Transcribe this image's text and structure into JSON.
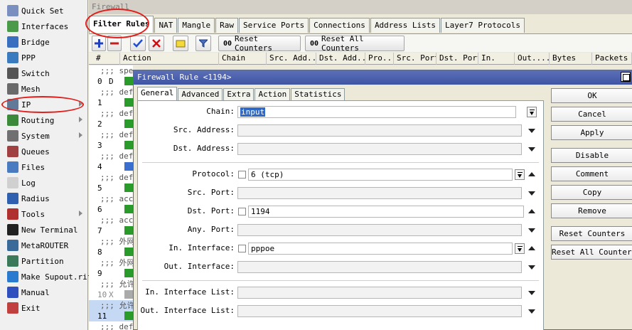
{
  "sidebar": {
    "items": [
      {
        "label": "Quick Set",
        "icon": "quick-set-icon",
        "arrow": false
      },
      {
        "label": "Interfaces",
        "icon": "interfaces-icon",
        "arrow": false
      },
      {
        "label": "Bridge",
        "icon": "bridge-icon",
        "arrow": false
      },
      {
        "label": "PPP",
        "icon": "ppp-icon",
        "arrow": false
      },
      {
        "label": "Switch",
        "icon": "switch-icon",
        "arrow": false
      },
      {
        "label": "Mesh",
        "icon": "mesh-icon",
        "arrow": false
      },
      {
        "label": "IP",
        "icon": "ip-icon",
        "arrow": true
      },
      {
        "label": "Routing",
        "icon": "routing-icon",
        "arrow": true
      },
      {
        "label": "System",
        "icon": "system-icon",
        "arrow": true
      },
      {
        "label": "Queues",
        "icon": "queues-icon",
        "arrow": false
      },
      {
        "label": "Files",
        "icon": "files-icon",
        "arrow": false
      },
      {
        "label": "Log",
        "icon": "log-icon",
        "arrow": false
      },
      {
        "label": "Radius",
        "icon": "radius-icon",
        "arrow": false
      },
      {
        "label": "Tools",
        "icon": "tools-icon",
        "arrow": true
      },
      {
        "label": "New Terminal",
        "icon": "terminal-icon",
        "arrow": false
      },
      {
        "label": "MetaROUTER",
        "icon": "metarouter-icon",
        "arrow": false
      },
      {
        "label": "Partition",
        "icon": "partition-icon",
        "arrow": false
      },
      {
        "label": "Make Supout.rif",
        "icon": "supout-icon",
        "arrow": false
      },
      {
        "label": "Manual",
        "icon": "manual-icon",
        "arrow": false
      },
      {
        "label": "Exit",
        "icon": "exit-icon",
        "arrow": false
      }
    ]
  },
  "main": {
    "title": "Firewall",
    "tabs": [
      "Filter Rules",
      "NAT",
      "Mangle",
      "Raw",
      "Service Ports",
      "Connections",
      "Address Lists",
      "Layer7 Protocols"
    ],
    "toolbar": {
      "reset_counters": "Reset Counters",
      "reset_all_counters": "Reset All Counters",
      "counter_badge": "00"
    },
    "columns": [
      "#",
      "Action",
      "Chain",
      "Src. Add...",
      "Dst. Add...",
      "Pro...",
      "Src. Port",
      "Dst. Port",
      "In.",
      "Out....",
      "Bytes",
      "Packets"
    ],
    "rows": [
      {
        "num": "",
        "comment": ";;; spe",
        "flag": ""
      },
      {
        "num": "0",
        "comment": "",
        "flag": "D"
      },
      {
        "num": "",
        "comment": ";;; def",
        "flag": ""
      },
      {
        "num": "1",
        "comment": "",
        "flag": ""
      },
      {
        "num": "",
        "comment": ";;; def",
        "flag": ""
      },
      {
        "num": "2",
        "comment": "",
        "flag": ""
      },
      {
        "num": "",
        "comment": ";;; def",
        "flag": ""
      },
      {
        "num": "3",
        "comment": "",
        "flag": ""
      },
      {
        "num": "",
        "comment": ";;; def",
        "flag": ""
      },
      {
        "num": "4",
        "comment": "",
        "flag": ""
      },
      {
        "num": "",
        "comment": ";;; def",
        "flag": ""
      },
      {
        "num": "5",
        "comment": "",
        "flag": ""
      },
      {
        "num": "",
        "comment": ";;; acc",
        "flag": ""
      },
      {
        "num": "6",
        "comment": "",
        "flag": ""
      },
      {
        "num": "",
        "comment": ";;; acc",
        "flag": ""
      },
      {
        "num": "7",
        "comment": "",
        "flag": ""
      },
      {
        "num": "",
        "comment": ";;; 外网",
        "flag": ""
      },
      {
        "num": "8",
        "comment": "",
        "flag": ""
      },
      {
        "num": "",
        "comment": ";;; 外网",
        "flag": ""
      },
      {
        "num": "9",
        "comment": "",
        "flag": ""
      },
      {
        "num": "",
        "comment": ";;; 允许",
        "flag": ""
      },
      {
        "num": "10",
        "comment": "",
        "flag": "X"
      },
      {
        "num": "",
        "comment": ";;; 允许",
        "flag": ""
      },
      {
        "num": "11",
        "comment": "",
        "flag": ""
      },
      {
        "num": "",
        "comment": ";;; def",
        "flag": ""
      }
    ]
  },
  "dialog": {
    "title": "Firewall Rule <1194>",
    "tabs": [
      "General",
      "Advanced",
      "Extra",
      "Action",
      "Statistics"
    ],
    "fields": {
      "chain": {
        "label": "Chain:",
        "value": "input"
      },
      "src_address": {
        "label": "Src. Address:",
        "value": ""
      },
      "dst_address": {
        "label": "Dst. Address:",
        "value": ""
      },
      "protocol": {
        "label": "Protocol:",
        "value": "6 (tcp)"
      },
      "src_port": {
        "label": "Src. Port:",
        "value": ""
      },
      "dst_port": {
        "label": "Dst. Port:",
        "value": "1194"
      },
      "any_port": {
        "label": "Any. Port:",
        "value": ""
      },
      "in_interface": {
        "label": "In. Interface:",
        "value": "pppoe"
      },
      "out_interface": {
        "label": "Out. Interface:",
        "value": ""
      },
      "in_interface_list": {
        "label": "In. Interface List:",
        "value": ""
      },
      "out_interface_list": {
        "label": "Out. Interface List:",
        "value": ""
      }
    },
    "buttons": {
      "ok": "OK",
      "cancel": "Cancel",
      "apply": "Apply",
      "disable": "Disable",
      "comment": "Comment",
      "copy": "Copy",
      "remove": "Remove",
      "reset_counters": "Reset Counters",
      "reset_all_counters": "Reset All Counters"
    }
  }
}
